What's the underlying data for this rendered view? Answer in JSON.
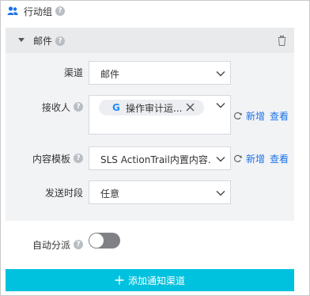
{
  "header": {
    "title": "行动组",
    "icon": "user-group-icon",
    "help_icon": "question-icon"
  },
  "channel_panel": {
    "title": "邮件",
    "help_icon": "question-icon",
    "collapse_icon": "caret-down-icon",
    "delete_icon": "trash-icon",
    "channel": {
      "label": "渠道",
      "value": "邮件"
    },
    "recipients": {
      "label": "接收人",
      "tag_prefix": "G",
      "tag_text": "操作审计运...",
      "add_label": "新增",
      "view_label": "查看"
    },
    "template": {
      "label": "内容模板",
      "value": "SLS ActionTrail内置内容...",
      "add_label": "新增",
      "view_label": "查看"
    },
    "send_period": {
      "label": "发送时段",
      "value": "任意"
    }
  },
  "auto_dispatch": {
    "label": "自动分派",
    "enabled": false
  },
  "add_channel_button": {
    "label": "添加通知渠道",
    "icon": "plus-icon"
  },
  "colors": {
    "accent": "#00c1de",
    "link": "#1a73e8",
    "panel_bg": "#f2f3f5",
    "toggle_off": "#7f8185"
  }
}
